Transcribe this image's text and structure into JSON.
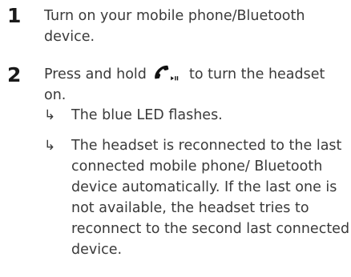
{
  "steps": [
    {
      "number": "1",
      "text": "Turn on your mobile phone/Bluetooth device."
    },
    {
      "number": "2",
      "text_before_icon": "Press and hold",
      "icon": "call-play-pause-icon",
      "text_after_icon": "to turn the headset on.",
      "results": [
        {
          "arrow": "↳",
          "text": "The blue LED flashes."
        },
        {
          "arrow": "↳",
          "text": "The headset is reconnected to the last connected mobile phone/ Bluetooth device automatically. If the last one is not available, the headset tries to reconnect to the second last connected device."
        }
      ]
    }
  ]
}
